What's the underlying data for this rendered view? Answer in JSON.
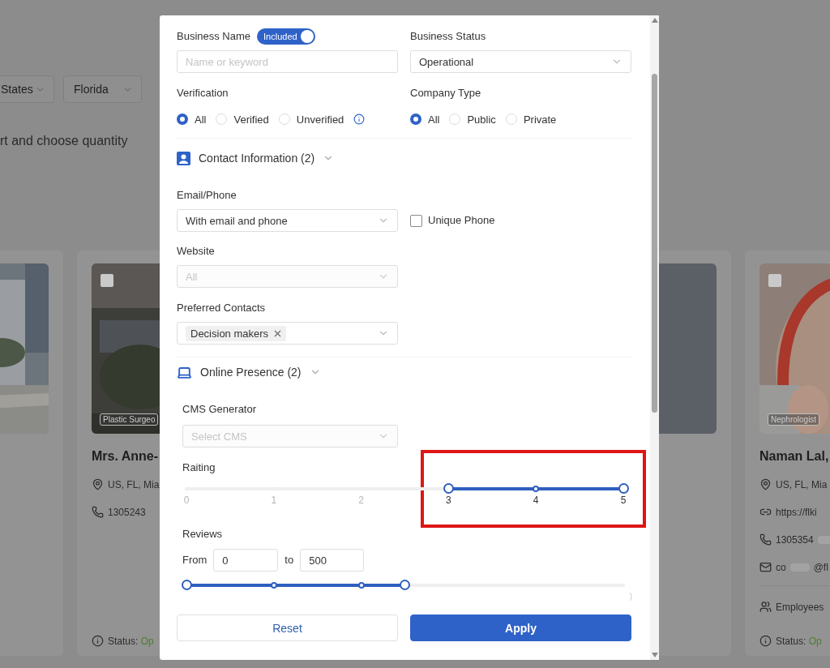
{
  "background": {
    "filters": [
      {
        "value": "States"
      },
      {
        "value": "Florida"
      }
    ],
    "hint": "rt and choose quantity",
    "cards": [
      {
        "photo": {
          "kind": "street"
        }
      },
      {
        "photo": {
          "kind": "shop"
        },
        "checked": false,
        "tag": "Plastic Surgeo",
        "name": "Mrs. Anne-",
        "location": "US, FL, Mia",
        "phone": "1305243",
        "status_label": "Status:",
        "status": "Op"
      },
      {
        "photo": {
          "kind": "empty"
        }
      },
      {
        "photo": {
          "kind": "person"
        },
        "checked": false,
        "tag": "Nephrologist",
        "name": "Naman Lal,",
        "location": "US, FL, Mia",
        "website": "https://flki",
        "phone": "1305354",
        "email": [
          "co",
          "@fl"
        ],
        "employees": "Employees",
        "status_label": "Status:",
        "status": "Op"
      }
    ]
  },
  "modal": {
    "business_name": {
      "label": "Business Name",
      "toggle": {
        "label": "Included",
        "on": true
      },
      "placeholder": "Name or keyword"
    },
    "business_status": {
      "label": "Business Status",
      "value": "Operational"
    },
    "verification": {
      "label": "Verification",
      "info": true,
      "options": [
        {
          "label": "All",
          "selected": true
        },
        {
          "label": "Verified",
          "selected": false
        },
        {
          "label": "Unverified",
          "selected": false
        }
      ]
    },
    "company_type": {
      "label": "Company Type",
      "options": [
        {
          "label": "All",
          "selected": true
        },
        {
          "label": "Public",
          "selected": false
        },
        {
          "label": "Private",
          "selected": false
        }
      ]
    },
    "contact_information": {
      "title": "Contact Information (2)"
    },
    "email_phone": {
      "label": "Email/Phone",
      "value": "With email and phone"
    },
    "unique_phone": {
      "label": "Unique Phone",
      "checked": false
    },
    "website": {
      "label": "Website",
      "placeholder": "All"
    },
    "preferred_contacts": {
      "label": "Preferred Contacts",
      "tags": [
        "Decision makers"
      ]
    },
    "online_presence": {
      "title": "Online Presence (2)"
    },
    "cms_generator": {
      "label": "CMS Generator",
      "placeholder": "Select CMS"
    },
    "rating": {
      "label": "Raiting",
      "highlighted": true,
      "marks": [
        {
          "label": "0",
          "in_range": false
        },
        {
          "label": "1",
          "in_range": false
        },
        {
          "label": "2",
          "in_range": false
        },
        {
          "label": "3",
          "in_range": true
        },
        {
          "label": "4",
          "in_range": true
        },
        {
          "label": "5",
          "in_range": true
        }
      ],
      "thumbs": [
        {
          "level": 0.6
        },
        {
          "level": 1
        }
      ]
    },
    "reviews": {
      "label": "Reviews",
      "from_label": "From",
      "from": "0",
      "to_label": "to",
      "to": "500",
      "end_label": ")",
      "marks": [
        {
          "in_range": true
        },
        {
          "in_range": true
        },
        {
          "in_range": true
        },
        {
          "in_range": false
        },
        {
          "in_range": false
        },
        {
          "in_range": false
        }
      ],
      "thumbs": [
        {
          "level": 0
        },
        {
          "level": 0.5
        }
      ]
    },
    "buttons": [
      {
        "label": "Reset",
        "kind": "secondary"
      },
      {
        "label": "Apply",
        "kind": "primary"
      }
    ]
  }
}
